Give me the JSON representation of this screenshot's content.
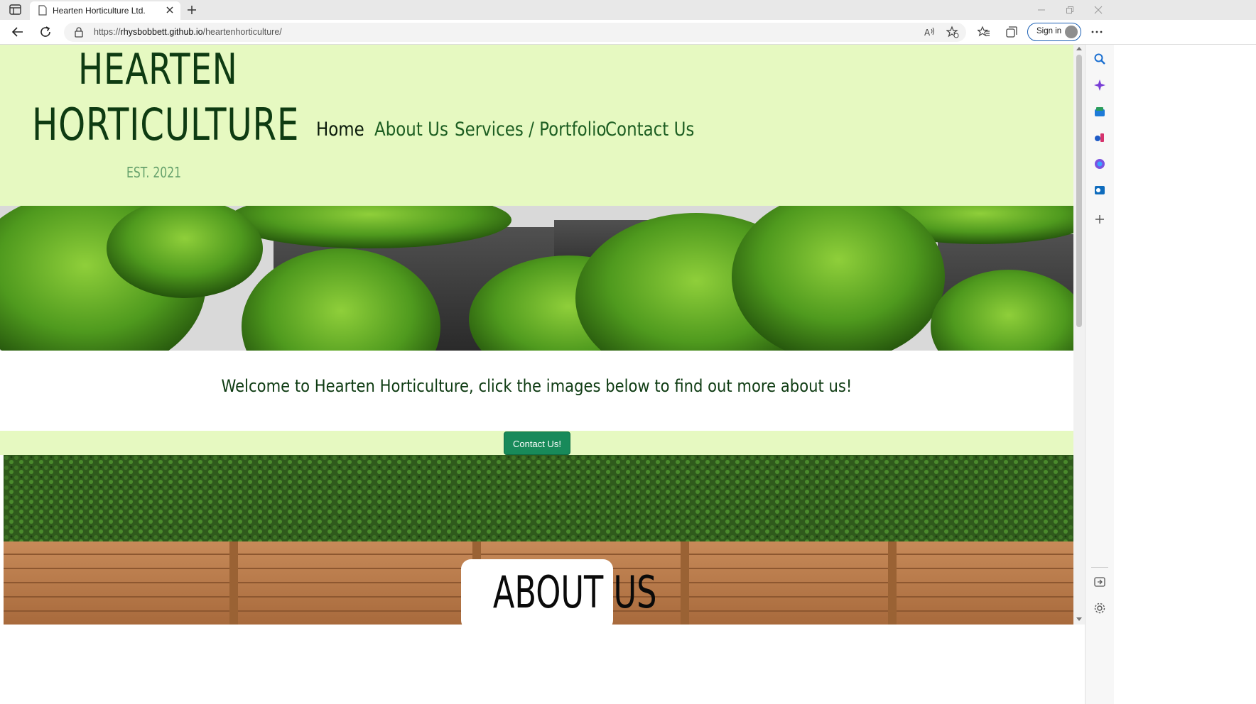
{
  "browser": {
    "tab_title": "Hearten Horticulture Ltd.",
    "url_prefix": "https://",
    "url_host": "rhysbobbett.github.io",
    "url_path": "/heartenhorticulture/",
    "signin_label": "Sign in"
  },
  "site": {
    "logo_line1": "HEARTEN",
    "logo_line2": "HORTICULTURE",
    "established": "EST. 2021",
    "nav": {
      "home": "Home",
      "about": "About Us",
      "services": "Services / Portfolio",
      "contact": "Contact Us"
    },
    "welcome": "Welcome to Hearten Horticulture, click the images below to find out more about us!",
    "contact_button": "Contact Us!",
    "about_heading": "ABOUT US"
  },
  "colors": {
    "header_bg": "#e6f9c1",
    "logo_text": "#0e3b12",
    "nav_text": "#1d5e22",
    "button_bg": "#188a5a"
  }
}
